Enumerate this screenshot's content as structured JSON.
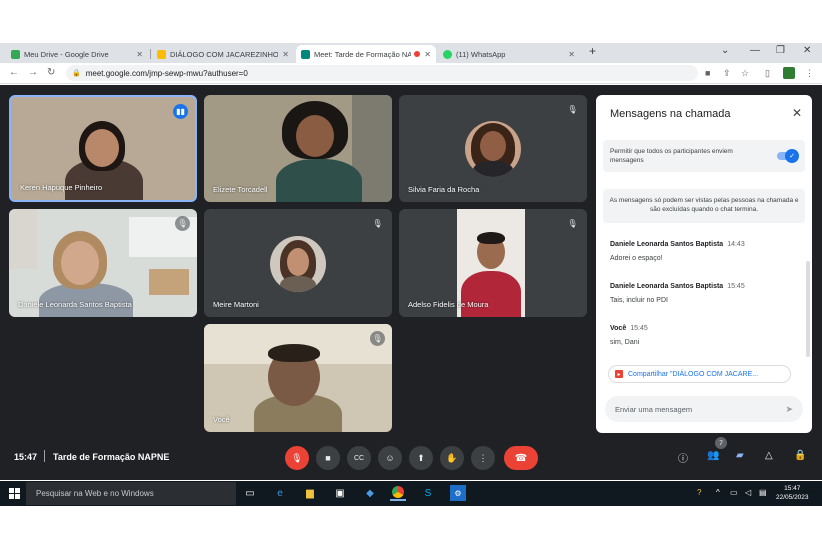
{
  "browser": {
    "tabs": [
      {
        "title": "Meu Drive - Google Drive",
        "color": "#34a853",
        "active": false
      },
      {
        "title": "DIÁLOGO COM JACAREZINHO.pp",
        "color": "#fbbc04",
        "active": false
      },
      {
        "title": "Meet: Tarde de Formação NA",
        "color": "#00897b",
        "active": true
      },
      {
        "title": "(11) WhatsApp",
        "color": "#25d366",
        "active": false
      }
    ],
    "url": "meet.google.com/jmp-sewp-mwu?authuser=0"
  },
  "participants": [
    {
      "name": "Keren Hapuque Pinheiro",
      "speaking": true
    },
    {
      "name": "Elizete Torcadell",
      "speaking": false
    },
    {
      "name": "Silvia Faria da Rocha",
      "speaking": false
    },
    {
      "name": "Daniele Leonarda Santos Baptista",
      "speaking": false
    },
    {
      "name": "Meire Martoni",
      "speaking": false
    },
    {
      "name": "Adelso Fidelis de Moura",
      "speaking": false
    },
    {
      "name": "Você",
      "speaking": false
    }
  ],
  "chat": {
    "title": "Mensagens na chamada",
    "permission_text": "Permitir que todos os participantes enviem mensagens",
    "permission_enabled": true,
    "notice": "As mensagens só podem ser vistas pelas pessoas na chamada e são excluídas quando o chat termina.",
    "messages": [
      {
        "sender": "Daniele Leonarda Santos Baptista",
        "time": "14:43",
        "text": "Adorei o espaço!"
      },
      {
        "sender": "Daniele Leonarda Santos Baptista",
        "time": "15:45",
        "text": "Tais, incluir no PDI"
      },
      {
        "sender": "Você",
        "time": "15:45",
        "text": "sim, Dani"
      }
    ],
    "share_label": "Compartilhar \"DIÁLOGO COM JACARE...",
    "input_placeholder": "Enviar uma mensagem"
  },
  "meeting": {
    "time": "15:47",
    "name": "Tarde de Formação NAPNE",
    "participant_count": "7"
  },
  "taskbar": {
    "search_placeholder": "Pesquisar na Web e no Windows",
    "clock_time": "15:47",
    "clock_date": "22/05/2023"
  }
}
